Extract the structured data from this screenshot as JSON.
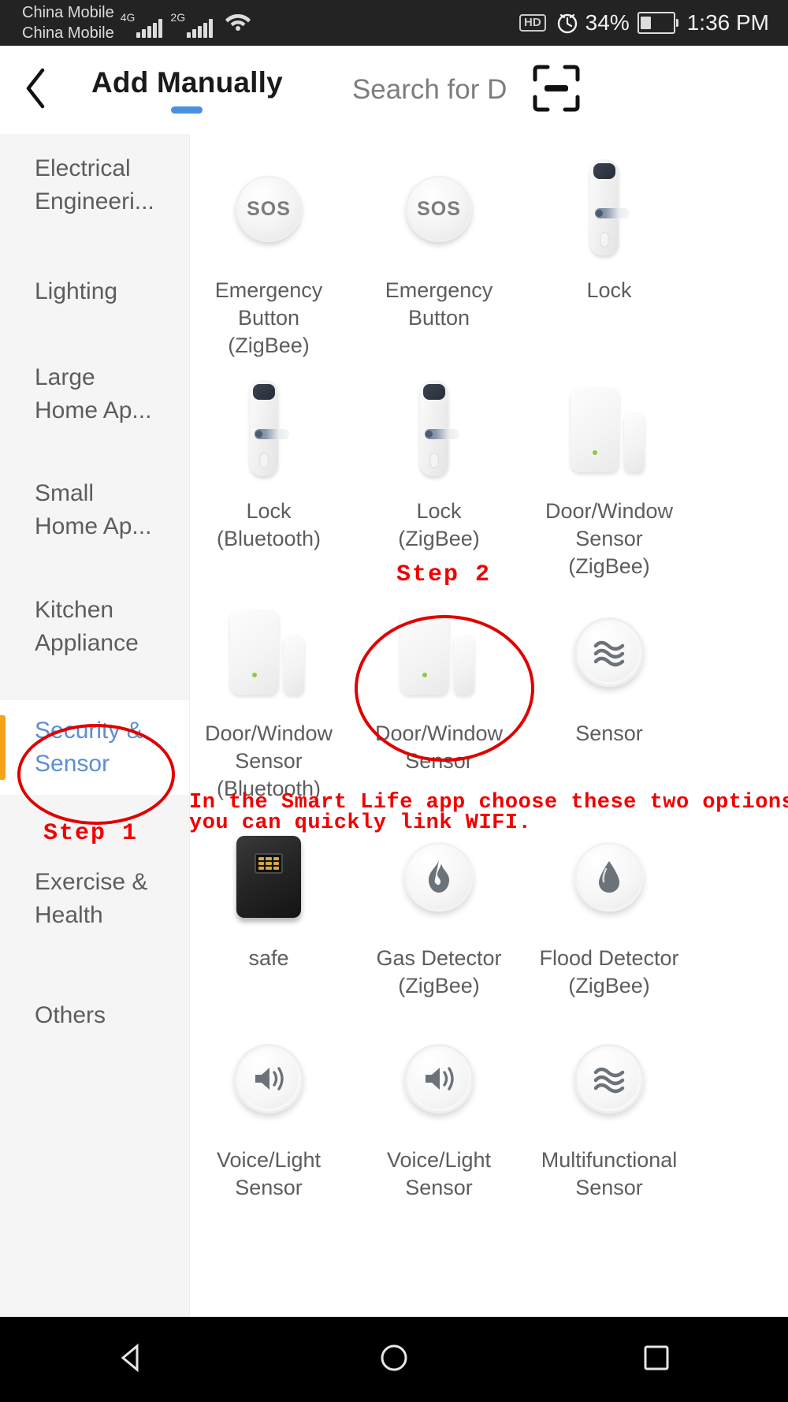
{
  "status_bar": {
    "carrier_primary": "China Mobile",
    "carrier_secondary": "China Mobile",
    "network_primary": "4G",
    "network_secondary": "2G",
    "wifi_icon": "wifi-icon",
    "hd_badge": "HD",
    "alarm_icon": "alarm-clock-icon",
    "battery_percent": "34%",
    "time": "1:36 PM"
  },
  "header": {
    "back_icon": "back-chevron-icon",
    "tab_active": "Add Manually",
    "tab_inactive": "Search for D",
    "scan_icon": "scan-qr-icon",
    "accent_color": "#4a90e2"
  },
  "sidebar": {
    "items": [
      {
        "label": "Electrical Engineeri...",
        "active": false
      },
      {
        "label": "Lighting",
        "active": false
      },
      {
        "label": "Large Home Ap...",
        "active": false
      },
      {
        "label": "Small Home Ap...",
        "active": false
      },
      {
        "label": "Kitchen Appliance",
        "active": false
      },
      {
        "label": "Security & Sensor",
        "active": true
      },
      {
        "label": "Exercise & Health",
        "active": false
      },
      {
        "label": "Others",
        "active": false
      }
    ],
    "active_color": "#5b8fd4",
    "indicator_color": "#f7a21b"
  },
  "devices": [
    {
      "name": "Emergency Button (ZigBee)",
      "lines": [
        "Emergency",
        "Button",
        "(ZigBee)"
      ],
      "icon": "sos-button-icon"
    },
    {
      "name": "Emergency Button",
      "lines": [
        "Emergency",
        "Button"
      ],
      "icon": "sos-button-icon"
    },
    {
      "name": "Lock",
      "lines": [
        "Lock"
      ],
      "icon": "door-lock-icon"
    },
    {
      "name": "Lock (Bluetooth)",
      "lines": [
        "Lock",
        "(Bluetooth)"
      ],
      "icon": "door-lock-icon"
    },
    {
      "name": "Lock (ZigBee)",
      "lines": [
        "Lock",
        "(ZigBee)"
      ],
      "icon": "door-lock-icon"
    },
    {
      "name": "Door/Window Sensor (ZigBee)",
      "lines": [
        "Door/Window",
        "Sensor",
        "(ZigBee)"
      ],
      "icon": "door-window-sensor-icon"
    },
    {
      "name": "Door/Window Sensor (Bluetooth)",
      "lines": [
        "Door/Window",
        "Sensor",
        "(Bluetooth)"
      ],
      "icon": "door-window-sensor-icon"
    },
    {
      "name": "Door/Window Sensor",
      "lines": [
        "Door/Window",
        "Sensor"
      ],
      "icon": "door-window-sensor-icon"
    },
    {
      "name": "Sensor",
      "lines": [
        "Sensor"
      ],
      "icon": "wave-sensor-icon"
    },
    {
      "name": "safe",
      "lines": [
        "safe"
      ],
      "icon": "safe-box-icon"
    },
    {
      "name": "Gas Detector (ZigBee)",
      "lines": [
        "Gas Detector",
        "(ZigBee)"
      ],
      "icon": "flame-icon"
    },
    {
      "name": "Flood Detector (ZigBee)",
      "lines": [
        "Flood Detector",
        "(ZigBee)"
      ],
      "icon": "water-drop-icon"
    },
    {
      "name": "Voice/Light Sensor",
      "lines": [
        "Voice/Light",
        "Sensor"
      ],
      "icon": "speaker-icon"
    },
    {
      "name": "Voice/Light Sensor",
      "lines": [
        "Voice/Light",
        "Sensor"
      ],
      "icon": "speaker-icon"
    },
    {
      "name": "Multifunctional Sensor",
      "lines": [
        "Multifunctional",
        "Sensor"
      ],
      "icon": "wave-sensor-icon"
    }
  ],
  "annotations": {
    "color": "#f00000",
    "step1_label": "Step 1",
    "step2_label": "Step 2",
    "note_line1": "In the Smart Life app choose these two options,",
    "note_line2": "you can quickly link WIFI."
  },
  "navbar": {
    "back_icon": "nav-back-triangle-icon",
    "home_icon": "nav-home-circle-icon",
    "recents_icon": "nav-recents-square-icon"
  }
}
